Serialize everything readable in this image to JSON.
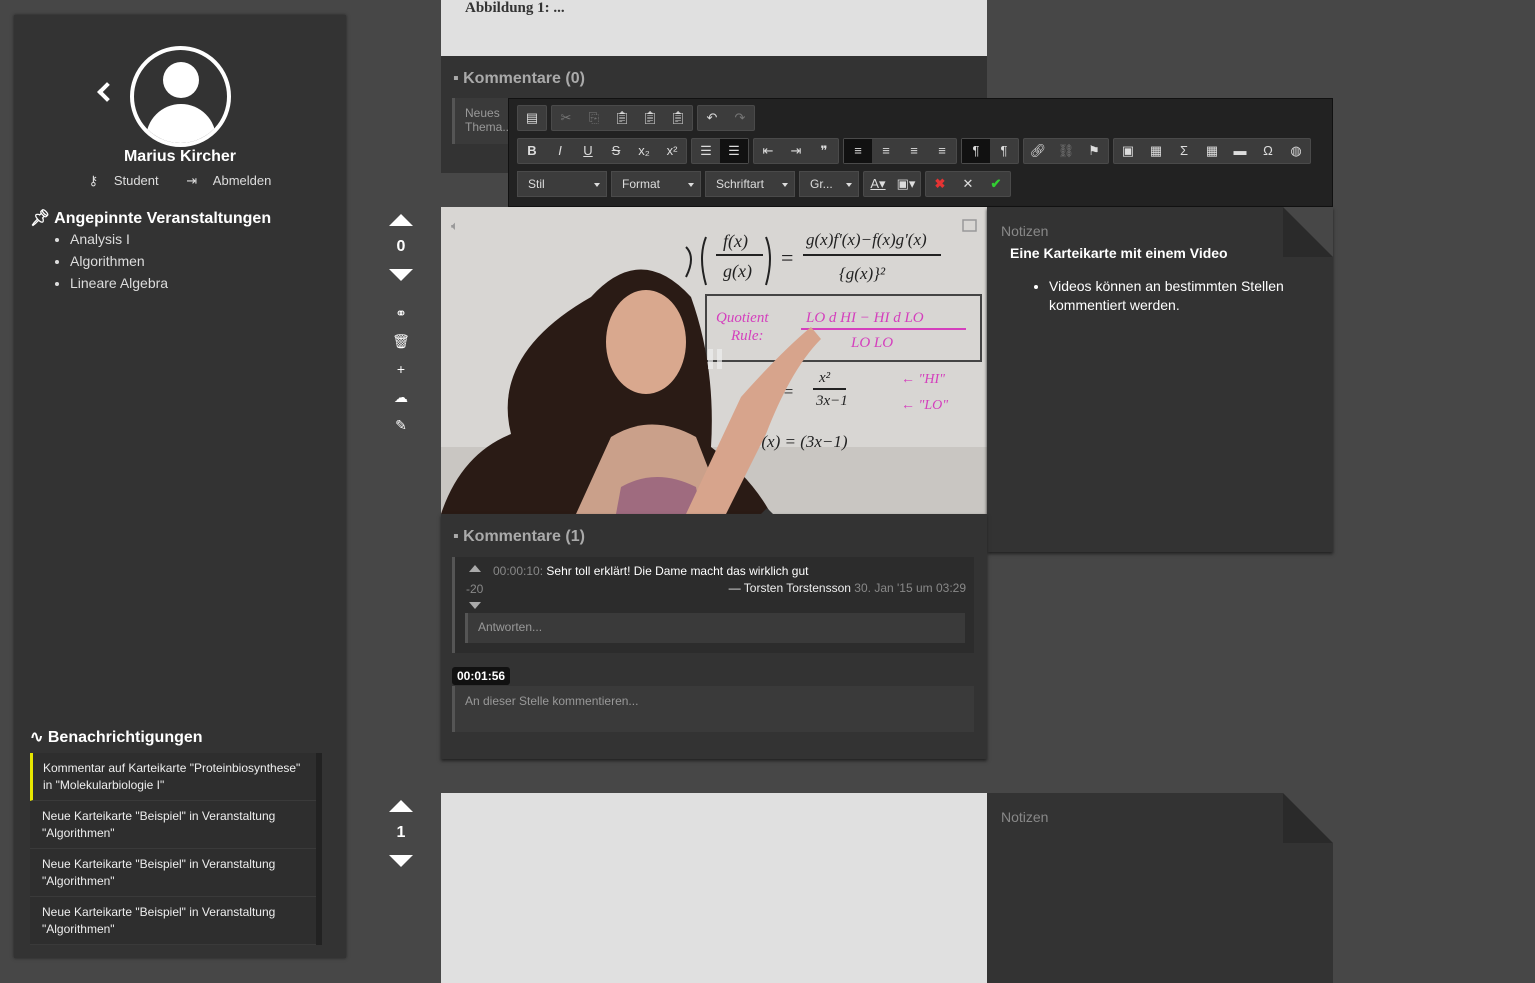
{
  "user": {
    "name": "Marius Kircher",
    "role": "Student",
    "logout": "Abmelden"
  },
  "pinned": {
    "title": "Angepinnte Veranstaltungen",
    "items": [
      "Analysis I",
      "Algorithmen",
      "Lineare Algebra"
    ]
  },
  "notifications": {
    "title": "Benachrichtigungen",
    "items": [
      "Kommentar auf Karteikarte \"Proteinbiosynthese\" in \"Molekularbiologie I\"",
      "Neue Karteikarte \"Beispiel\" in Veranstaltung \"Algorithmen\"",
      "Neue Karteikarte \"Beispiel\" in Veranstaltung \"Algorithmen\"",
      "Neue Karteikarte \"Beispiel\" in Veranstaltung \"Algorithmen\""
    ]
  },
  "card1": {
    "caption": "Abbildung 1: ...",
    "comments_title": "Kommentare (0)",
    "new_comment_placeholder": "Neues Thema..."
  },
  "toolbar": {
    "combo_style": "Stil",
    "combo_format": "Format",
    "combo_font": "Schriftart",
    "combo_size": "Gr..."
  },
  "card2": {
    "votes": "0",
    "notes_label": "Notizen",
    "notes_heading": "Eine Karteikarte mit einem Video",
    "notes_bullet": "Videos können an bestimmten Stellen kommentiert werden.",
    "comments_title": "Kommentare (1)",
    "comment": {
      "time": "00:00:10:",
      "text": "Sehr toll erklärt! Die Dame macht das wirklich gut",
      "score": "-20",
      "author": "— Torsten Torstensson",
      "date": "30. Jan '15 um 03:29"
    },
    "reply_placeholder": "Antworten...",
    "timestamp": "00:01:56",
    "comment_here_placeholder": "An dieser Stelle kommentieren..."
  },
  "card3": {
    "votes": "1",
    "notes_label": "Notizen"
  }
}
